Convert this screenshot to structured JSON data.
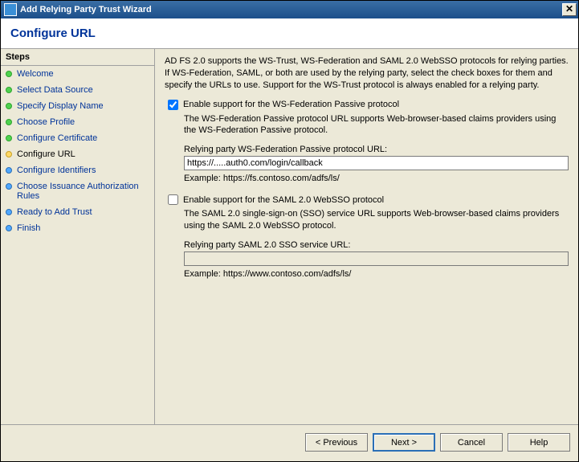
{
  "window": {
    "title": "Add Relying Party Trust Wizard"
  },
  "header": {
    "title": "Configure URL"
  },
  "sidebar": {
    "header": "Steps",
    "items": [
      {
        "label": "Welcome",
        "state": "done"
      },
      {
        "label": "Select Data Source",
        "state": "done"
      },
      {
        "label": "Specify Display Name",
        "state": "done"
      },
      {
        "label": "Choose Profile",
        "state": "done"
      },
      {
        "label": "Configure Certificate",
        "state": "done"
      },
      {
        "label": "Configure URL",
        "state": "current"
      },
      {
        "label": "Configure Identifiers",
        "state": "todo"
      },
      {
        "label": "Choose Issuance Authorization Rules",
        "state": "todo"
      },
      {
        "label": "Ready to Add Trust",
        "state": "todo"
      },
      {
        "label": "Finish",
        "state": "todo"
      }
    ]
  },
  "content": {
    "intro": "AD FS 2.0 supports the WS-Trust, WS-Federation and SAML 2.0 WebSSO protocols for relying parties.  If WS-Federation, SAML, or both are used by the relying party, select the check boxes for them and specify the URLs to use.  Support for the WS-Trust protocol is always enabled for a relying party.",
    "wsfed": {
      "checkbox_label": "Enable support for the WS-Federation Passive protocol",
      "checked": true,
      "desc": "The WS-Federation Passive protocol URL supports Web-browser-based claims providers using the WS-Federation Passive protocol.",
      "url_label": "Relying party WS-Federation Passive protocol URL:",
      "url_value": "https://.....auth0.com/login/callback",
      "example": "Example: https://fs.contoso.com/adfs/ls/"
    },
    "saml": {
      "checkbox_label": "Enable support for the SAML 2.0 WebSSO protocol",
      "checked": false,
      "desc": "The SAML 2.0 single-sign-on (SSO) service URL supports Web-browser-based claims providers using the SAML 2.0 WebSSO protocol.",
      "url_label": "Relying party SAML 2.0 SSO service URL:",
      "url_value": "",
      "example": "Example: https://www.contoso.com/adfs/ls/"
    }
  },
  "footer": {
    "previous": "< Previous",
    "next": "Next >",
    "cancel": "Cancel",
    "help": "Help"
  }
}
